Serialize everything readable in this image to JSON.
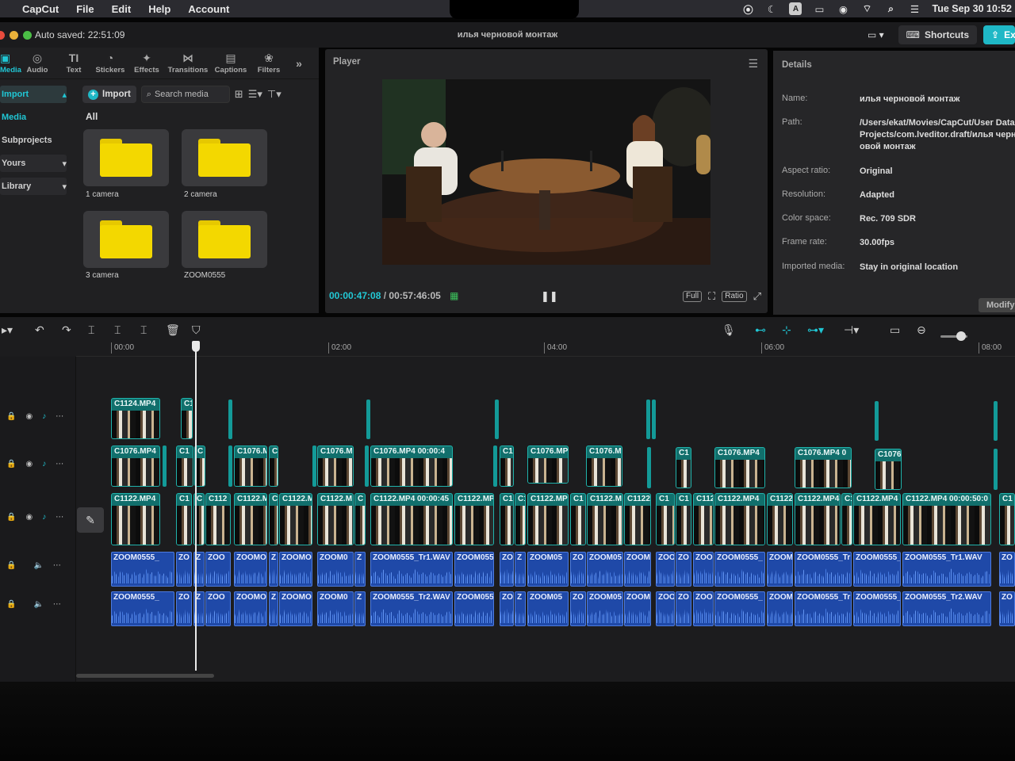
{
  "menubar": {
    "app": "CapCut",
    "items": [
      "File",
      "Edit",
      "Help",
      "Account"
    ],
    "clock": "Tue Sep 30 10:52"
  },
  "titlebar": {
    "autosave": "Auto saved: 22:51:09",
    "project": "илья черновой монтаж",
    "shortcuts": "Shortcuts",
    "export": "Ex"
  },
  "tools": [
    {
      "label": "Media",
      "icon": "media-icon",
      "glyph": "▣"
    },
    {
      "label": "Audio",
      "icon": "audio-icon",
      "glyph": "◎"
    },
    {
      "label": "Text",
      "icon": "text-icon",
      "glyph": "TI"
    },
    {
      "label": "Stickers",
      "icon": "stickers-icon",
      "glyph": "◔"
    },
    {
      "label": "Effects",
      "icon": "effects-icon",
      "glyph": "✦"
    },
    {
      "label": "Transitions",
      "icon": "transitions-icon",
      "glyph": "⋈"
    },
    {
      "label": "Captions",
      "icon": "captions-icon",
      "glyph": "▤"
    },
    {
      "label": "Filters",
      "icon": "filters-icon",
      "glyph": "❀"
    }
  ],
  "sidenav": [
    "Import",
    "Media",
    "Subprojects",
    "Yours",
    "Library"
  ],
  "media": {
    "import_label": "Import",
    "search_placeholder": "Search media",
    "all_label": "All",
    "folders": [
      "1 camera",
      "2 camera",
      "3 camera",
      "ZOOM0555"
    ]
  },
  "player": {
    "title": "Player",
    "current": "00:00:47:08",
    "total": "00:57:46:05",
    "full": "Full",
    "ratio": "Ratio"
  },
  "details": {
    "title": "Details",
    "rows": [
      {
        "key": "Name:",
        "value": "илья черновой монтаж"
      },
      {
        "key": "Path:",
        "value": "/Users/ekat/Movies/CapCut/User Data/Projects/com.lveditor.draft/илья черновой монтаж"
      },
      {
        "key": "Aspect ratio:",
        "value": "Original"
      },
      {
        "key": "Resolution:",
        "value": "Adapted"
      },
      {
        "key": "Color space:",
        "value": "Rec. 709 SDR"
      },
      {
        "key": "Frame rate:",
        "value": "30.00fps"
      },
      {
        "key": "Imported media:",
        "value": "Stay in original location"
      }
    ],
    "modify": "Modify"
  },
  "timeline": {
    "ruler": [
      "00:00",
      "02:00",
      "04:00",
      "06:00",
      "08:00"
    ],
    "track1": [
      "C1124.MP4",
      "C1"
    ],
    "track2": [
      "C1076.MP4",
      "C1",
      "C",
      "C1076.M",
      "C",
      "C1076.M",
      "C1076.MP4  00:00:4",
      "C1",
      "C1076.MP",
      "C1076.M",
      "C1",
      "C1076.MP4",
      "C1076.MP4  0",
      "C1076"
    ],
    "track3": [
      "C1122.MP4",
      "C1",
      "C",
      "C112",
      "C1122.M",
      "C",
      "C1122.M",
      "C1122.M",
      "C",
      "C1122.MP4  00:00:45",
      "C1122.MP",
      "C1",
      "C1",
      "C1122.MP",
      "C1",
      "C1122.M",
      "C1122.",
      "C1",
      "C1",
      "C112",
      "C1122.MP4",
      "C1122",
      "C1122.MP4",
      "C1",
      "C1122.MP4",
      "C1122.MP4  00:00:50:0",
      "C1"
    ],
    "audio1": [
      "ZOOM0555_",
      "ZO",
      "Z",
      "ZOO",
      "ZOOMO",
      "Z",
      "ZOOMO",
      "ZOOM0",
      "Z",
      "ZOOM0555_Tr1.WAV",
      "ZOOM055",
      "ZO",
      "Z",
      "ZOOM05",
      "ZO",
      "ZOOM05",
      "ZOOM",
      "ZOO",
      "ZO",
      "ZOO",
      "ZOOM0555_",
      "ZOOM",
      "ZOOM0555_Tr",
      "ZOOM0555_",
      "ZOOM0555_Tr1.WAV",
      "ZO"
    ],
    "audio2": [
      "ZOOM0555_",
      "ZO",
      "Z",
      "ZOO",
      "ZOOMO",
      "Z",
      "ZOOMO",
      "ZOOM0",
      "Z",
      "ZOOM0555_Tr2.WAV",
      "ZOOM055",
      "ZO",
      "Z",
      "ZOOM05",
      "ZO",
      "ZOOM05",
      "ZOOM",
      "ZOO",
      "ZO",
      "ZOO",
      "ZOOM0555_",
      "ZOOM",
      "ZOOM0555_Tr",
      "ZOOM0555_",
      "ZOOM0555_Tr2.WAV",
      "ZO"
    ]
  },
  "colors": {
    "accent": "#20c6d4",
    "video_clip": "#116f6c",
    "audio_clip": "#1f49a8",
    "folder": "#f3d800"
  }
}
